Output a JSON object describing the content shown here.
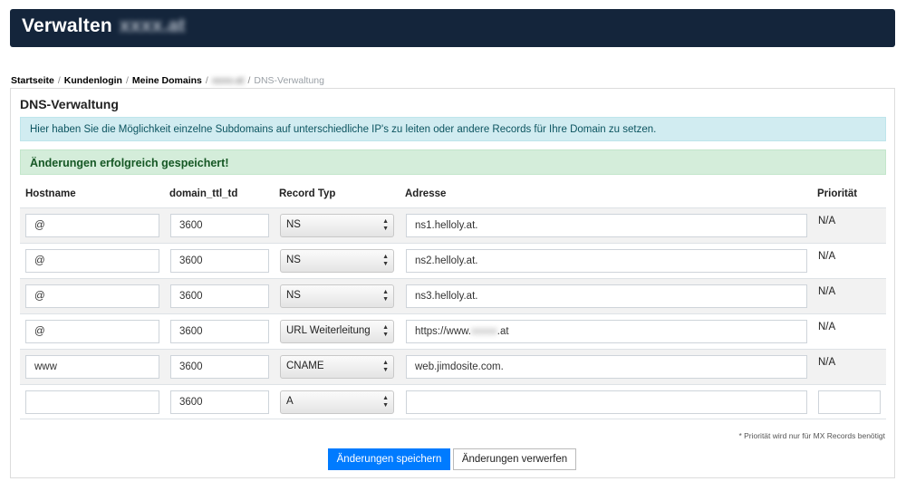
{
  "header": {
    "title": "Verwalten",
    "domain_blurred": "xxxx.at"
  },
  "breadcrumb": {
    "items": [
      "Startseite",
      "Kundenlogin",
      "Meine Domains"
    ],
    "domain_blurred": "xxxx.at",
    "active": "DNS-Verwaltung"
  },
  "panel": {
    "title": "DNS-Verwaltung",
    "info_text": "Hier haben Sie die Möglichkeit einzelne Subdomains auf unterschiedliche IP's zu leiten oder andere Records für Ihre Domain zu setzen.",
    "success_text": "Änderungen erfolgreich gespeichert!"
  },
  "table": {
    "headers": {
      "hostname": "Hostname",
      "ttl": "domain_ttl_td",
      "type": "Record Typ",
      "address": "Adresse",
      "priority": "Priorität"
    },
    "rows": [
      {
        "hostname": "@",
        "ttl": "3600",
        "type": "NS",
        "address": "ns1.helloly.at.",
        "priority": "N/A"
      },
      {
        "hostname": "@",
        "ttl": "3600",
        "type": "NS",
        "address": "ns2.helloly.at.",
        "priority": "N/A"
      },
      {
        "hostname": "@",
        "ttl": "3600",
        "type": "NS",
        "address": "ns3.helloly.at.",
        "priority": "N/A"
      },
      {
        "hostname": "@",
        "ttl": "3600",
        "type": "URL Weiterleitung",
        "address_prefix": "https://www.",
        "address_blurred": "xxxxx",
        "address_suffix": ".at",
        "priority": "N/A"
      },
      {
        "hostname": "www",
        "ttl": "3600",
        "type": "CNAME",
        "address": "web.jimdosite.com.",
        "priority": "N/A"
      },
      {
        "hostname": "",
        "ttl": "3600",
        "type": "A",
        "address": "",
        "priority": ""
      }
    ]
  },
  "note": "* Priorität wird nur für MX Records benötigt",
  "buttons": {
    "save": "Änderungen speichern",
    "discard": "Änderungen verwerfen"
  },
  "colors": {
    "header_bg": "#14253b",
    "info_bg": "#d1ecf1",
    "success_bg": "#d4edda",
    "primary": "#007bff"
  }
}
